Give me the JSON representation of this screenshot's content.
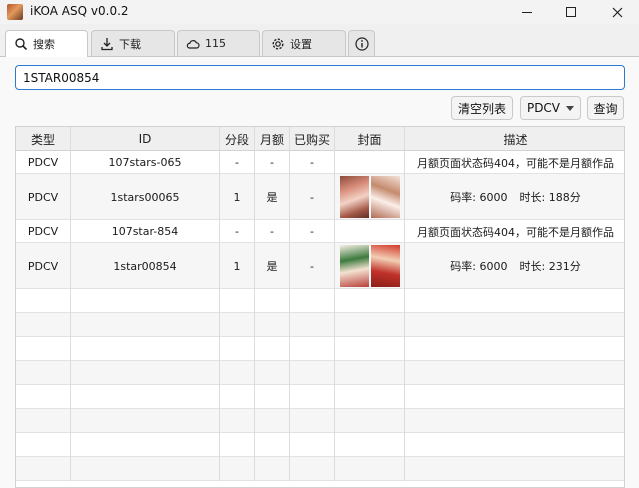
{
  "window": {
    "title": "iKOA ASQ v0.0.2"
  },
  "tabs": [
    {
      "label": "搜索",
      "icon": "search-icon"
    },
    {
      "label": "下载",
      "icon": "download-icon"
    },
    {
      "label": "115",
      "icon": "cloud-icon"
    },
    {
      "label": "设置",
      "icon": "gear-icon"
    },
    {
      "label": "",
      "icon": "info-icon"
    }
  ],
  "search": {
    "value": "1STAR00854"
  },
  "toolbar": {
    "clear_label": "清空列表",
    "type_label": "PDCV",
    "query_label": "查询"
  },
  "table": {
    "columns": [
      "类型",
      "ID",
      "分段",
      "月额",
      "已购买",
      "封面",
      "描述"
    ],
    "rows": [
      {
        "type": "PDCV",
        "id": "107stars-065",
        "seg": "-",
        "monthly": "-",
        "bought": "-",
        "desc": "月额页面状态码404，可能不是月额作品",
        "desc_bitrate": "",
        "desc_duration": ""
      },
      {
        "type": "PDCV",
        "id": "1stars00065",
        "seg": "1",
        "monthly": "是",
        "bought": "-",
        "desc": "",
        "desc_bitrate": "码率: 6000",
        "desc_duration": "时长: 188分"
      },
      {
        "type": "PDCV",
        "id": "107star-854",
        "seg": "-",
        "monthly": "-",
        "bought": "-",
        "desc": "月额页面状态码404，可能不是月额作品",
        "desc_bitrate": "",
        "desc_duration": ""
      },
      {
        "type": "PDCV",
        "id": "1star00854",
        "seg": "1",
        "monthly": "是",
        "bought": "-",
        "desc": "",
        "desc_bitrate": "码率: 6000",
        "desc_duration": "时长: 231分"
      }
    ]
  },
  "colors": {
    "accent": "#2a7bd4",
    "header_bg": "#efefef"
  }
}
